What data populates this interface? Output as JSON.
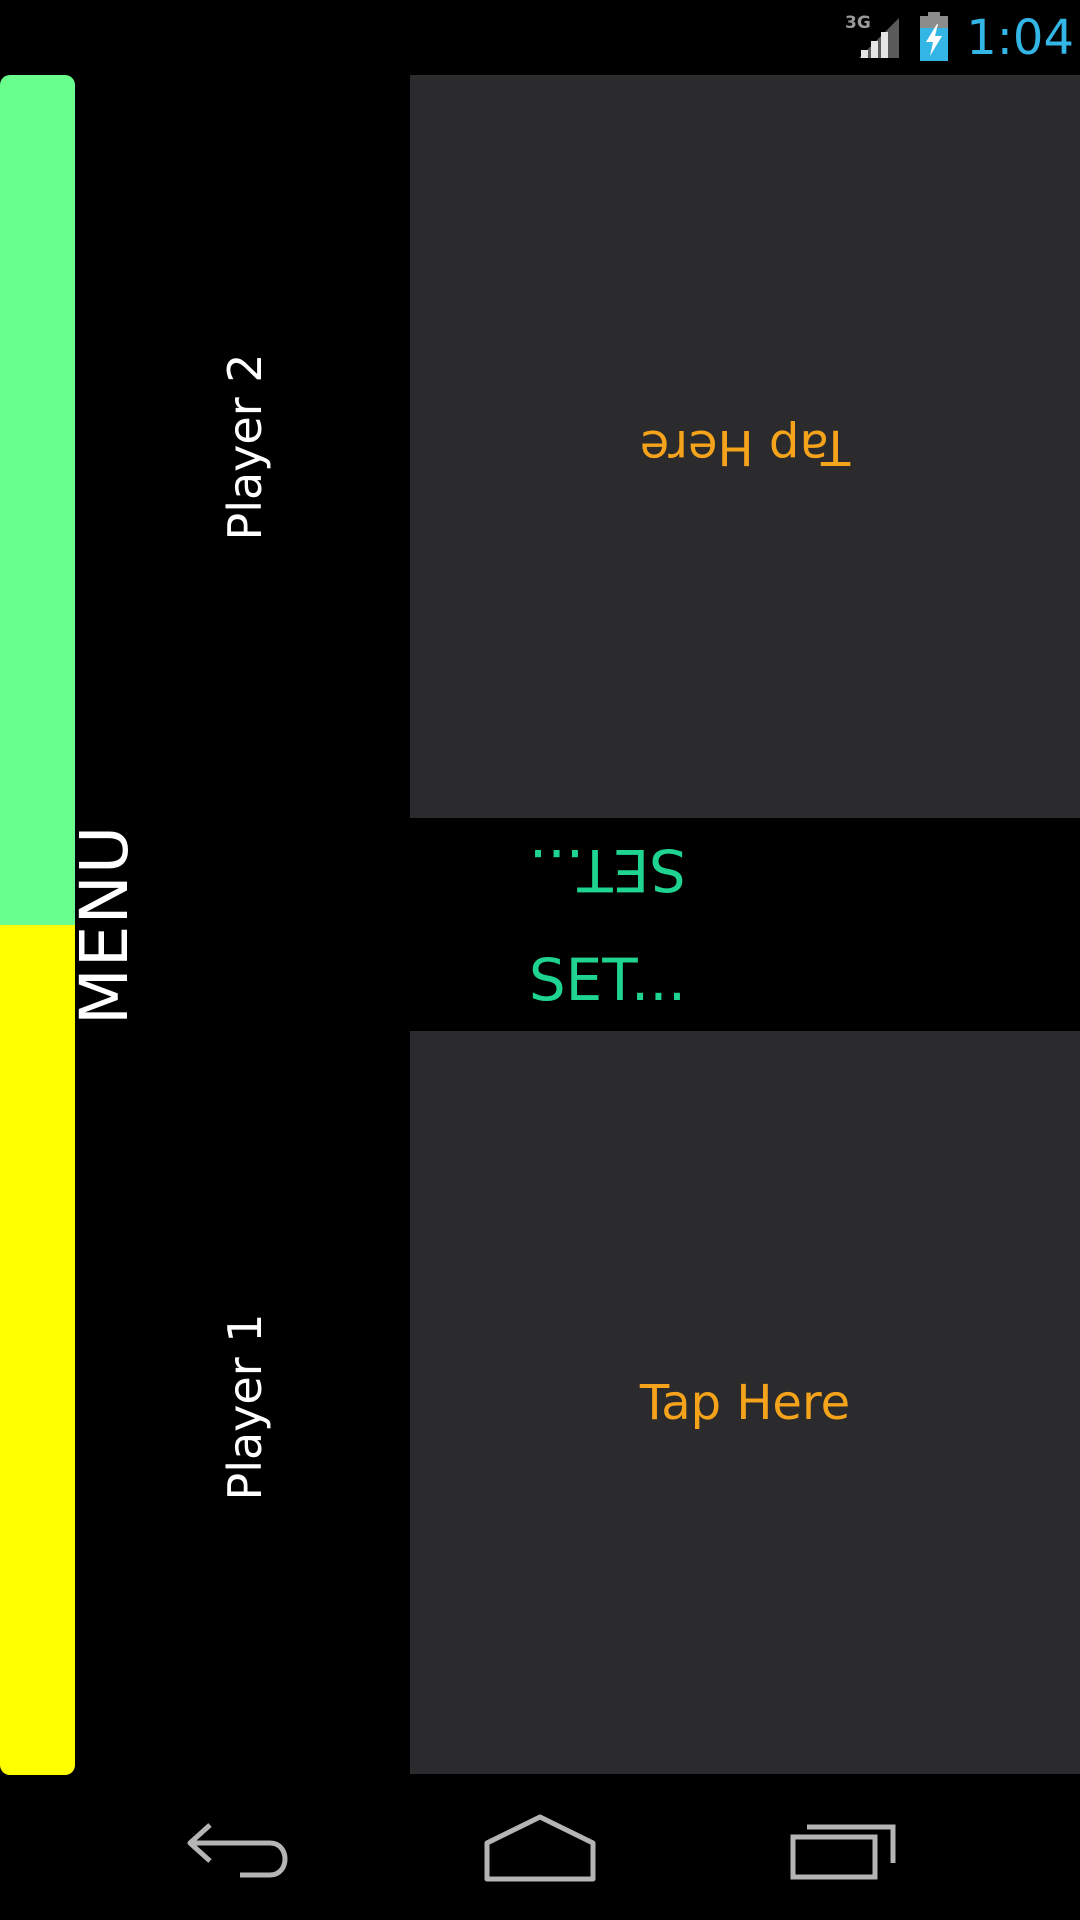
{
  "status_bar": {
    "network_type": "3G",
    "time": "1:04",
    "time_color": "#33b5e5",
    "icons": [
      "signal-3g-icon",
      "battery-charging-icon"
    ]
  },
  "menu": {
    "label": "MENU"
  },
  "players": {
    "player2": {
      "name": "Player 2",
      "color": "#69ff8c"
    },
    "player1": {
      "name": "Player 1",
      "color": "#ffff00"
    }
  },
  "panels": {
    "top": {
      "label": "Tap Here"
    },
    "bottom": {
      "label": "Tap Here"
    },
    "label_color": "#f5a31a",
    "panel_color": "#2b2a2c"
  },
  "set_buttons": {
    "top": {
      "label": "SET..."
    },
    "bottom": {
      "label": "SET..."
    },
    "color": "#1ed490"
  },
  "nav_bar": {
    "icons": [
      "back-icon",
      "home-icon",
      "recents-icon"
    ]
  }
}
